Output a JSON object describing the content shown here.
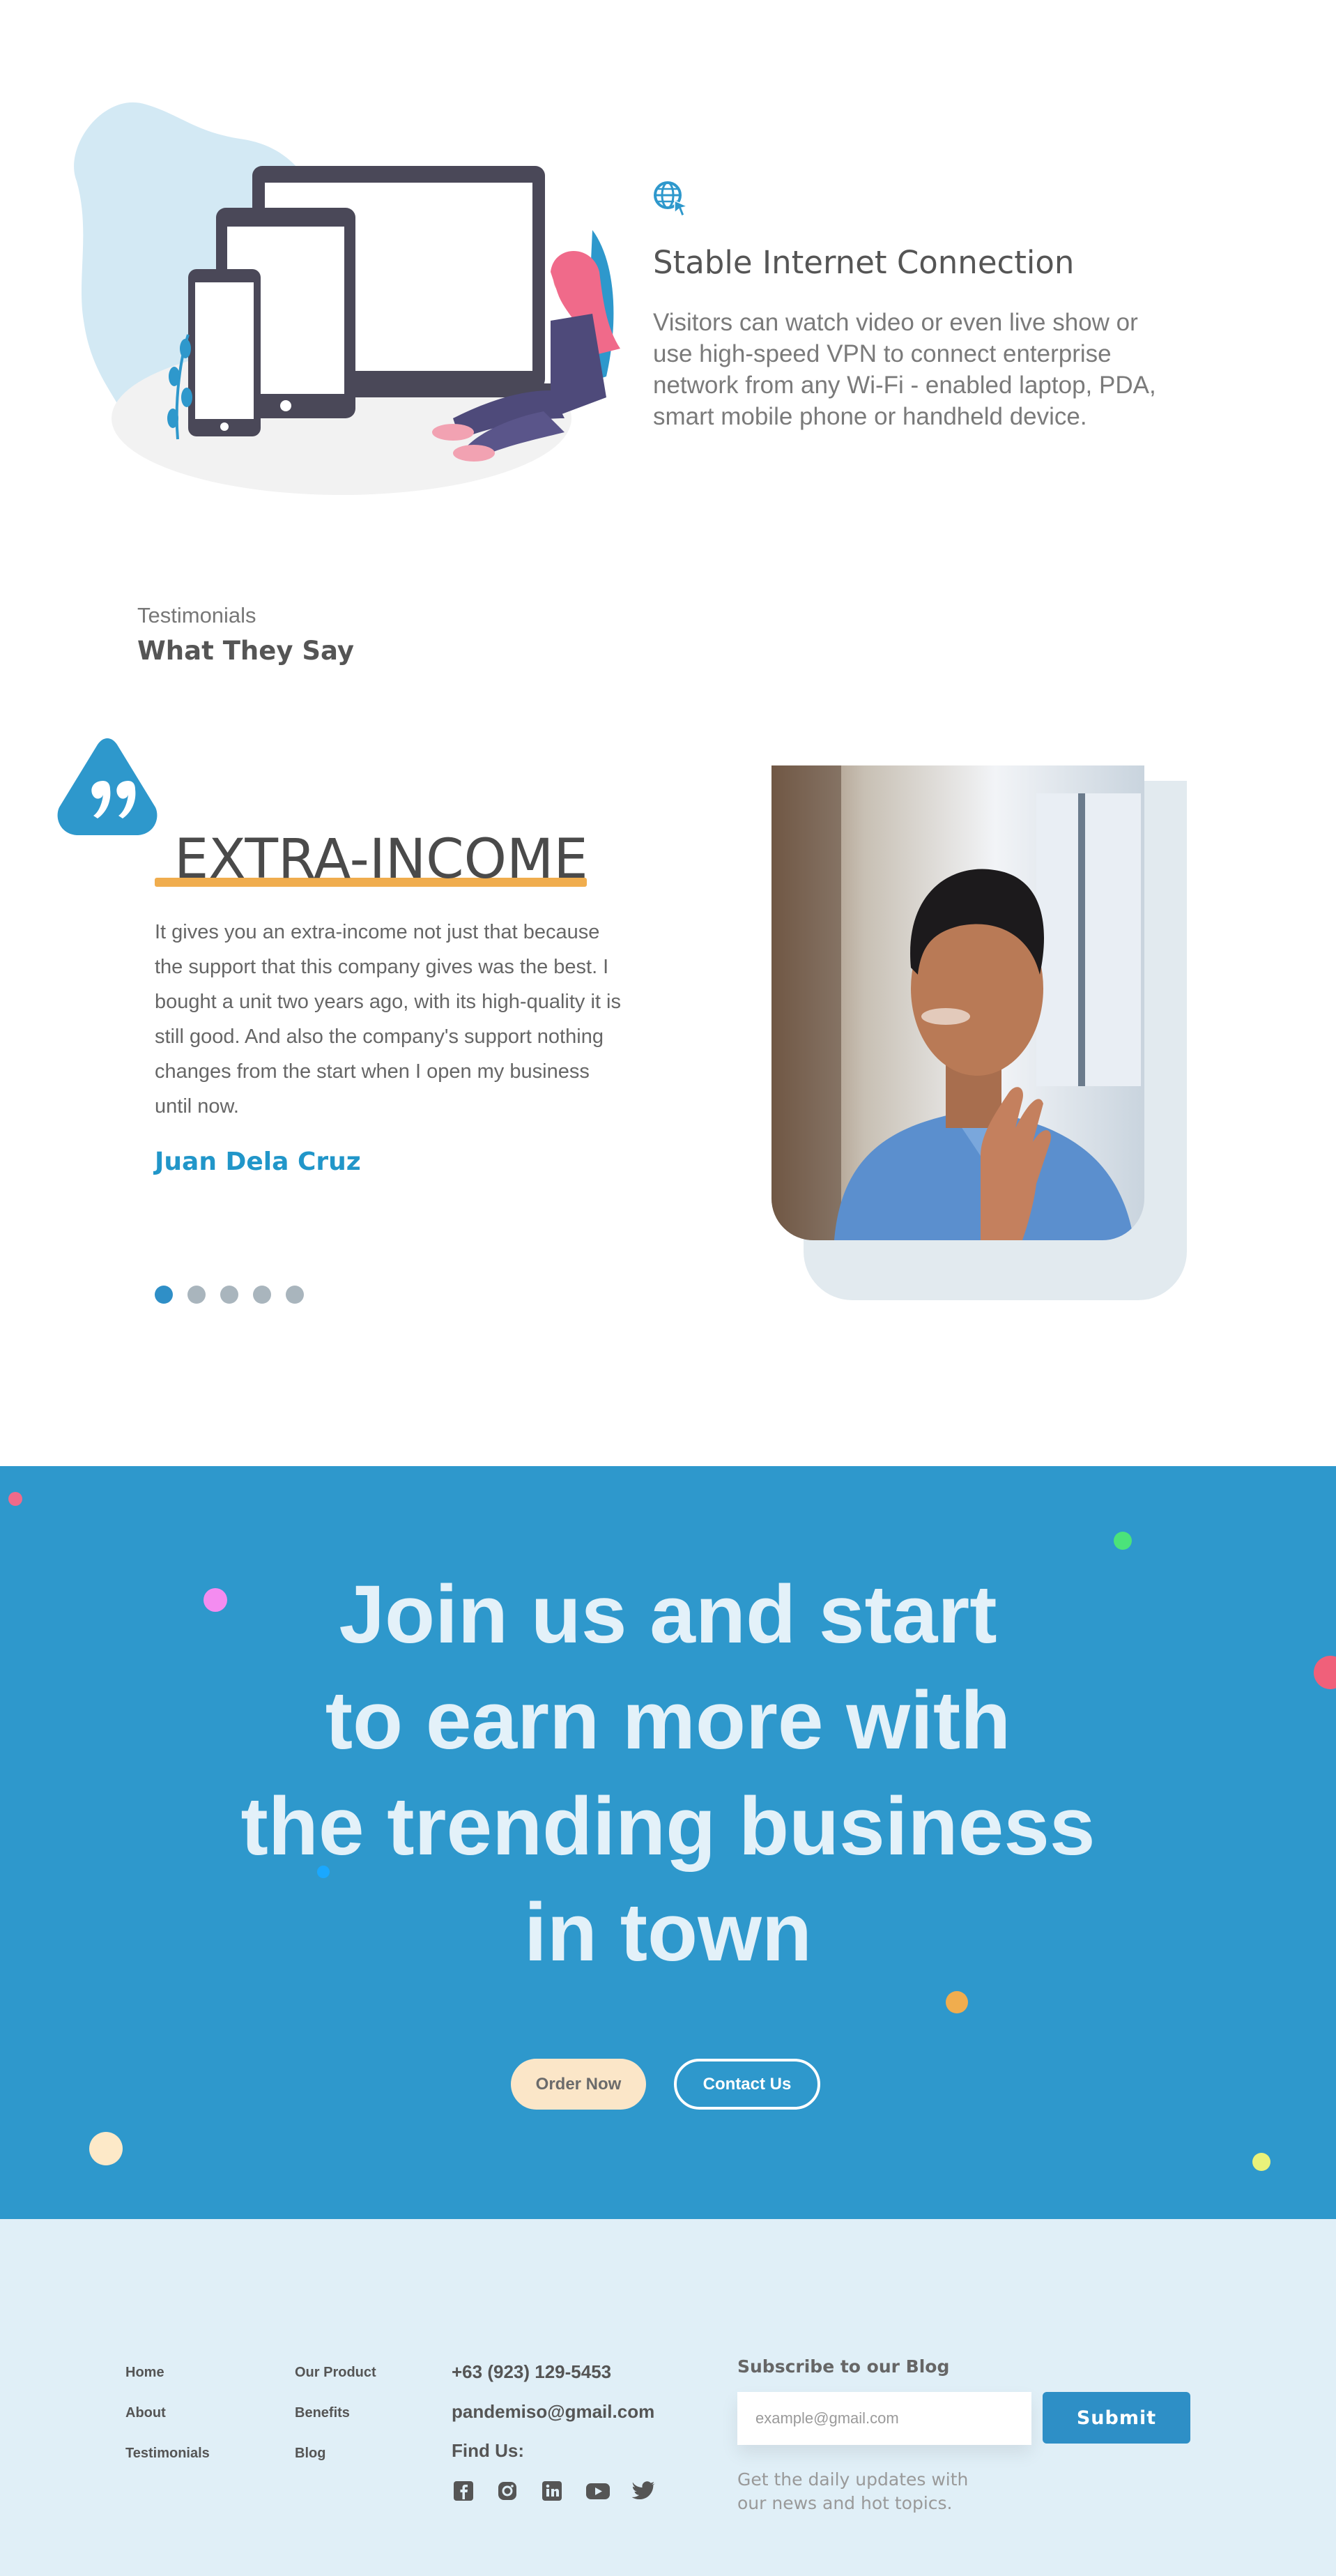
{
  "feature": {
    "icon": "globe-cursor-icon",
    "title": "Stable Internet Connection",
    "description": "Visitors can watch video or even live show or use high-speed VPN to connect enterprise network from any Wi-Fi - enabled laptop, PDA, smart mobile phone or handheld device."
  },
  "testimonials": {
    "kicker": "Testimonials",
    "heading": "What They Say",
    "quote_icon": "quote-icon",
    "title": "EXTRA-INCOME",
    "text": "It gives you an extra-income not just that because the support that this company gives was the best. I bought a unit two years ago, with its high-quality it is still good. And also the company's support nothing changes from the start when I open my business until now.",
    "author": "Juan Dela Cruz",
    "slides": 5,
    "active_slide": 1
  },
  "cta": {
    "headline_lines": [
      "Join us and start",
      "to earn more with",
      "the trending business",
      "in town"
    ],
    "order_label": "Order Now",
    "contact_label": "Contact Us"
  },
  "footer": {
    "col1": [
      "Home",
      "About",
      "Testimonials"
    ],
    "col2": [
      "Our Product",
      "Benefits",
      "Blog"
    ],
    "phone": "+63 (923) 129-5453",
    "email": "pandemiso@gmail.com",
    "find_us": "Find Us:",
    "social_icons": [
      "facebook-icon",
      "instagram-icon",
      "linkedin-icon",
      "youtube-icon",
      "twitter-icon"
    ],
    "subscribe_title": "Subscribe to our Blog",
    "subscribe_placeholder": "example@gmail.com",
    "subscribe_button": "Submit",
    "subscribe_note": "Get the daily updates with our news and hot topics."
  },
  "colors": {
    "accent": "#2e98cc",
    "underline": "#f0ad4e",
    "footer_bg": "#e0eff7",
    "order_button": "#fbe6c8"
  }
}
